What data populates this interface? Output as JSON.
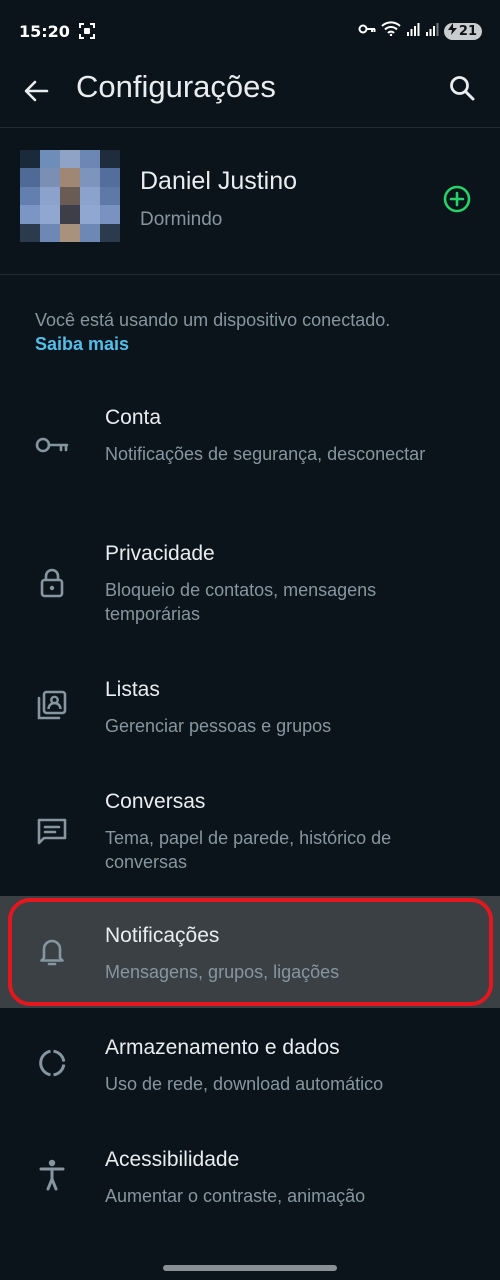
{
  "status_bar": {
    "time": "15:20",
    "battery": "21",
    "icons": [
      "screenshot-icon",
      "vpn-key-icon",
      "wifi-icon",
      "signal-icon",
      "signal-icon-2",
      "battery-icon"
    ]
  },
  "app_bar": {
    "title": "Configurações",
    "back_icon": "arrow-left-icon",
    "search_icon": "search-icon"
  },
  "profile": {
    "name": "Daniel Justino",
    "status": "Dormindo",
    "add_icon": "add-circle-icon",
    "accent": "#25d366"
  },
  "notice": {
    "text": "Você está usando um dispositivo conectado.",
    "link": "Saiba mais"
  },
  "settings": [
    {
      "title": "Conta",
      "subtitle": "Notificações de segurança, desconectar",
      "icon": "key-icon"
    },
    {
      "title": "Privacidade",
      "subtitle": "Bloqueio de contatos, mensagens temporárias",
      "icon": "lock-icon"
    },
    {
      "title": "Listas",
      "subtitle": "Gerenciar pessoas e grupos",
      "icon": "contact-list-icon"
    },
    {
      "title": "Conversas",
      "subtitle": "Tema, papel de parede, histórico de conversas",
      "icon": "chat-icon"
    },
    {
      "title": "Notificações",
      "subtitle": "Mensagens, grupos, ligações",
      "icon": "bell-icon",
      "highlighted": true
    },
    {
      "title": "Armazenamento e dados",
      "subtitle": "Uso de rede, download automático",
      "icon": "storage-circle-icon"
    },
    {
      "title": "Acessibilidade",
      "subtitle": "Aumentar o contraste, animação",
      "icon": "accessibility-icon"
    }
  ],
  "colors": {
    "background": "#0b141a",
    "primary_text": "#e9edef",
    "secondary_text": "#8696a0",
    "link": "#53bdeb",
    "highlight_bg": "#3b4044",
    "annotation_ring": "#e4171f"
  }
}
